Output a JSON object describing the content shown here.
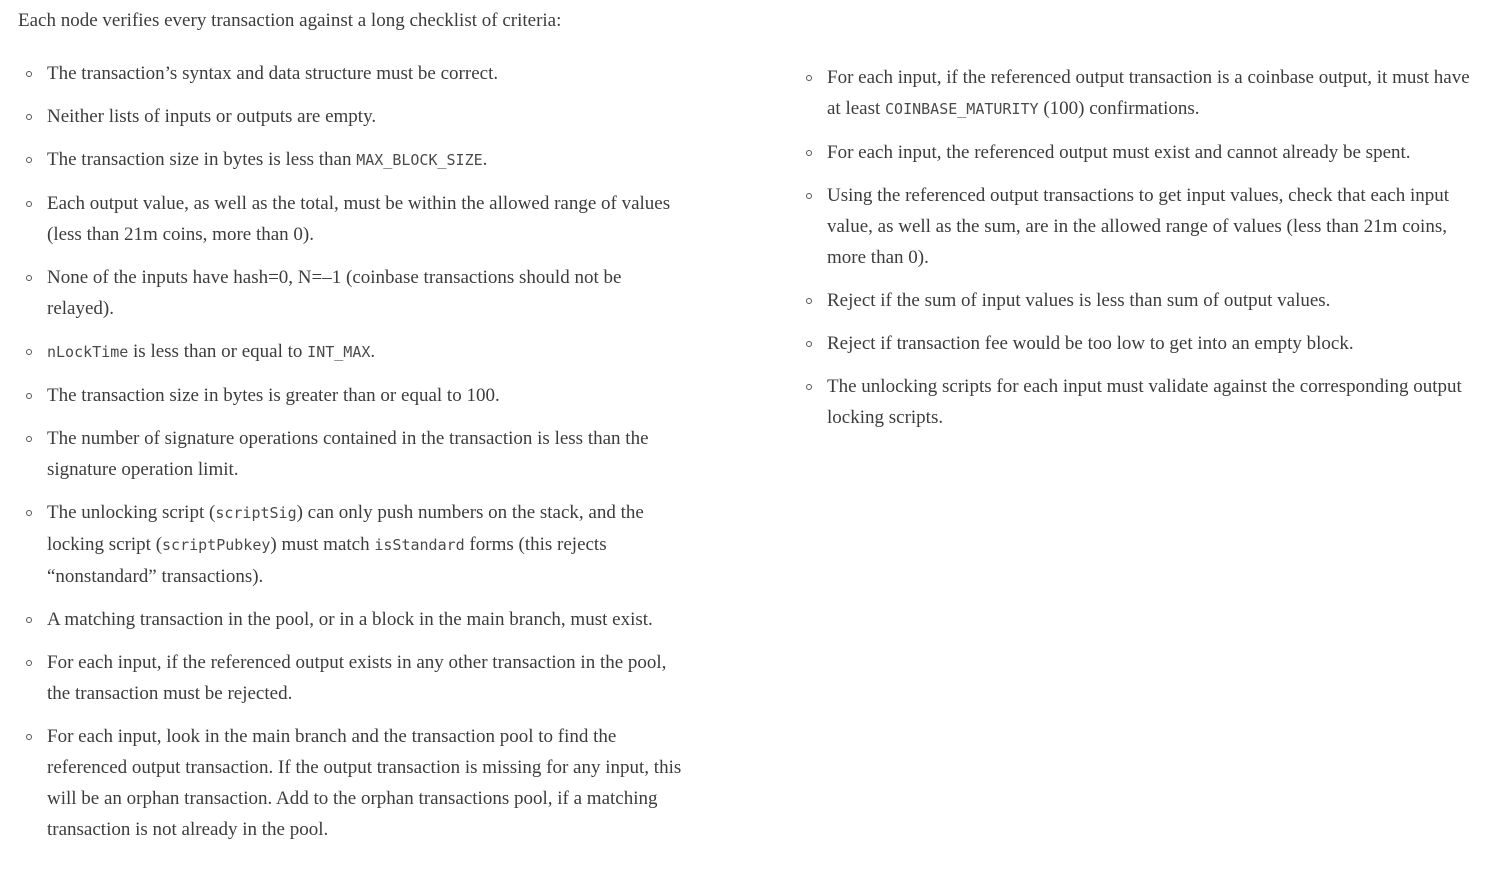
{
  "intro": "Each node verifies every transaction against a long checklist of criteria:",
  "left_items": [
    [
      {
        "t": "The transaction’s syntax and data structure must be correct."
      }
    ],
    [
      {
        "t": "Neither lists of inputs or outputs are empty."
      }
    ],
    [
      {
        "t": "The transaction size in bytes is less than "
      },
      {
        "c": "MAX_BLOCK_SIZE"
      },
      {
        "t": "."
      }
    ],
    [
      {
        "t": "Each output value, as well as the total, must be within the allowed range of values (less than 21m coins, more than 0)."
      }
    ],
    [
      {
        "t": "None of the inputs have hash=0, N=–1 (coinbase transactions should not be relayed)."
      }
    ],
    [
      {
        "c": "nLockTime"
      },
      {
        "t": " is less than or equal to "
      },
      {
        "c": "INT_MAX"
      },
      {
        "t": "."
      }
    ],
    [
      {
        "t": "The transaction size in bytes is greater than or equal to 100."
      }
    ],
    [
      {
        "t": "The number of signature operations contained in the transaction is less than the signature operation limit."
      }
    ],
    [
      {
        "t": "The unlocking script ("
      },
      {
        "c": "scriptSig"
      },
      {
        "t": ") can only push numbers on the stack, and the locking script ("
      },
      {
        "c": "scriptPubkey"
      },
      {
        "t": ") must match "
      },
      {
        "c": "isStandard"
      },
      {
        "t": " forms (this rejects “nonstandard” transactions)."
      }
    ],
    [
      {
        "t": "A matching transaction in the pool, or in a block in the main branch, must exist."
      }
    ],
    [
      {
        "t": "For each input, if the referenced output exists in any other transaction in the pool, the transaction must be rejected."
      }
    ],
    [
      {
        "t": "For each input, look in the main branch and the transaction pool to find the referenced output transaction. If the output transaction is missing for any input, this will be an orphan transaction. Add to the orphan transactions pool, if a matching transaction is not already in the pool."
      }
    ]
  ],
  "right_items": [
    [
      {
        "t": "For each input, if the referenced output transaction is a coinbase output, it must have at least "
      },
      {
        "c": "COINBASE_MATURITY"
      },
      {
        "t": " (100) confirmations."
      }
    ],
    [
      {
        "t": "For each input, the referenced output must exist and cannot already be spent."
      }
    ],
    [
      {
        "t": "Using the referenced output transactions to get input values, check that each input value, as well as the sum, are in the allowed range of values (less than 21m coins, more than 0)."
      }
    ],
    [
      {
        "t": "Reject if the sum of input values is less than sum of output values."
      }
    ],
    [
      {
        "t": "Reject if transaction fee would be too low to get into an empty block."
      }
    ],
    [
      {
        "t": "The unlocking scripts for each input must validate against the corresponding output locking scripts."
      }
    ]
  ]
}
